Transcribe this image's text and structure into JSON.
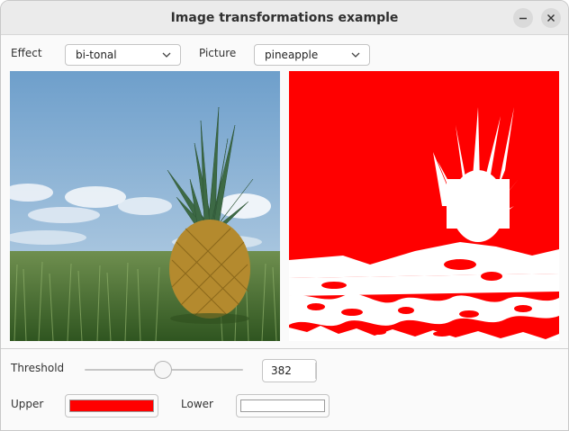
{
  "window": {
    "title": "Image transformations example",
    "minimize_icon": "minimize-icon",
    "close_icon": "close-icon"
  },
  "controls": {
    "effect_label": "Effect",
    "effect_value": "bi-tonal",
    "picture_label": "Picture",
    "picture_value": "pineapple",
    "threshold_label": "Threshold",
    "threshold_value": "382",
    "upper_label": "Upper",
    "lower_label": "Lower"
  },
  "colors": {
    "upper": "#ff0000",
    "lower": "#ffffff",
    "sky": "#7aa8d0",
    "grass": "#3f6b2a",
    "bitonal_fg": "#ffffff",
    "bitonal_bg": "#ff0000"
  }
}
